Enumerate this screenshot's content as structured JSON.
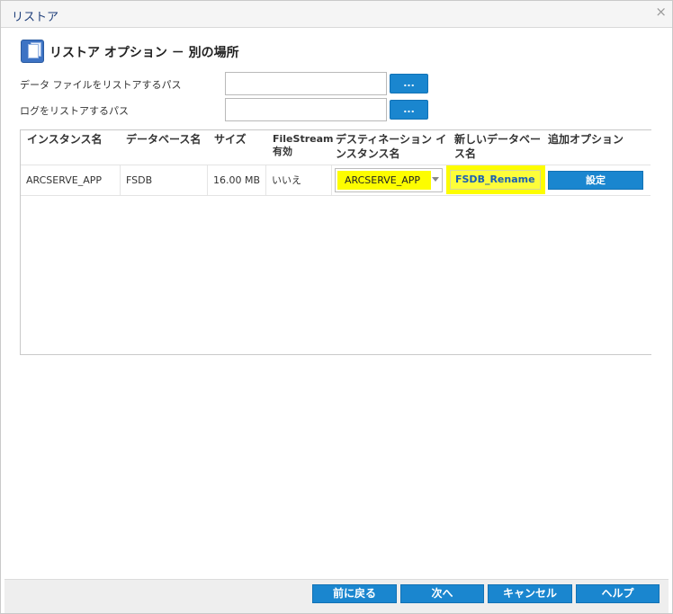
{
  "dialog": {
    "title": "リストア"
  },
  "section": {
    "title": "リストア オプション － 別の場所"
  },
  "fields": {
    "data_path_label": "データ ファイルをリストアするパス",
    "data_path_value": "",
    "log_path_label": "ログをリストアするパス",
    "log_path_value": "",
    "browse_label": "..."
  },
  "table": {
    "headers": {
      "instance": "インスタンス名",
      "database": "データベース名",
      "size": "サイズ",
      "filestream_line1": "FileStream",
      "filestream_line2": "有効",
      "dest_line1": "デスティネーション イ",
      "dest_line2": "ンスタンス名",
      "newname_line1": "新しいデータベー",
      "newname_line2": "ス名",
      "options": "追加オプション"
    },
    "rows": [
      {
        "instance": "ARCSERVE_APP",
        "database": "FSDB",
        "size": "16.00 MB",
        "filestream": "いいえ",
        "dest_instance": "ARCSERVE_APP",
        "new_name": "FSDB_Rename",
        "options_button": "設定"
      }
    ]
  },
  "footer": {
    "back": "前に戻る",
    "next": "次へ",
    "cancel": "キャンセル",
    "help": "ヘルプ"
  },
  "colors": {
    "accent": "#1a86cf",
    "highlight": "#fdfd00",
    "title": "#1f3f7a"
  }
}
